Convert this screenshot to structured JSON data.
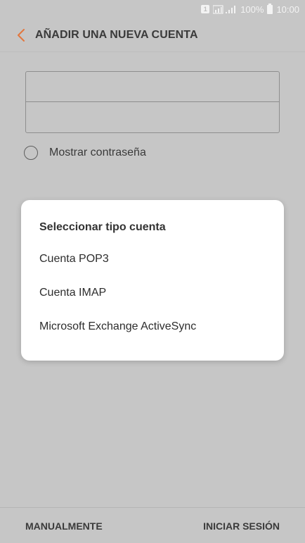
{
  "status_bar": {
    "sim_icon": "sim-card-icon",
    "sim_label": "1",
    "signal_icon": "signal-bars-icon",
    "battery_percent": "100%",
    "battery_icon": "battery-icon",
    "time": "10:00"
  },
  "header": {
    "back_icon": "chevron-left-icon",
    "title": "AÑADIR UNA NUEVA CUENTA",
    "accent_color": "#e2773e"
  },
  "form": {
    "email_value": "",
    "password_value": "",
    "show_password_label": "Mostrar contraseña"
  },
  "dialog": {
    "title": "Seleccionar tipo cuenta",
    "options": [
      {
        "label": "Cuenta POP3"
      },
      {
        "label": "Cuenta IMAP"
      },
      {
        "label": "Microsoft Exchange ActiveSync"
      }
    ]
  },
  "footer": {
    "manual_label": "MANUALMENTE",
    "login_label": "INICIAR SESIÓN"
  }
}
